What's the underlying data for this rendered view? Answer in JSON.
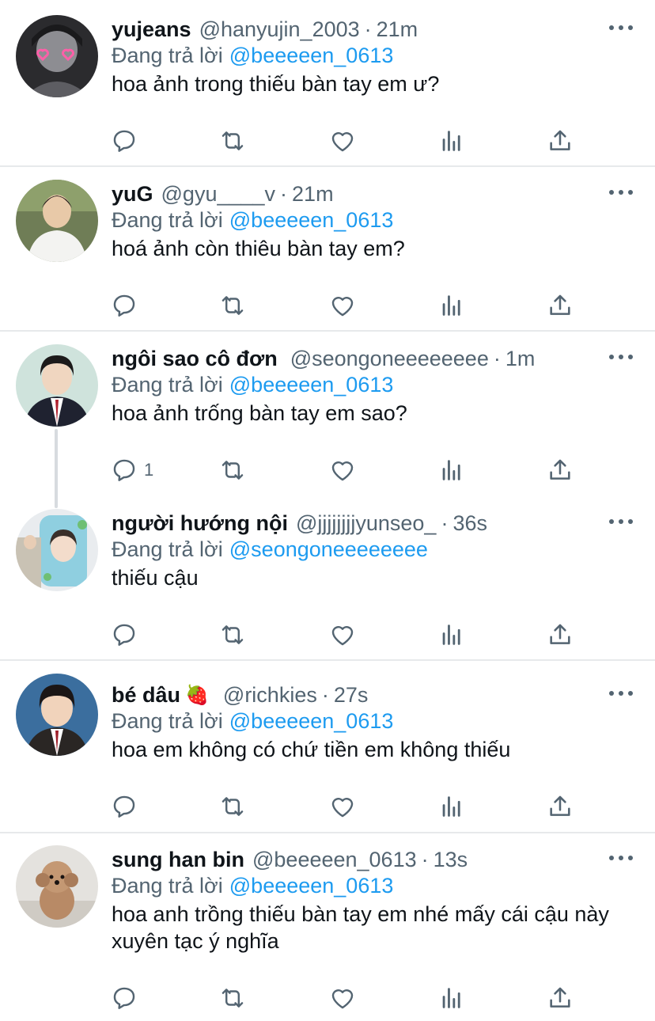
{
  "colors": {
    "accent": "#1d9bf0",
    "muted": "#536471",
    "text": "#0f1419",
    "divider": "#e7e9eb",
    "strawberry": "#e0245e"
  },
  "icons": {
    "reply": "speech-bubble",
    "retweet": "retweet-arrows",
    "like": "heart-outline",
    "analytics": "bar-chart",
    "share": "upload-arrow",
    "more": "three-dots"
  },
  "tweets": [
    {
      "name": "yujeans",
      "handle": "@hanyujin_2003",
      "time": "21m",
      "replying_label": "Đang trả lời",
      "reply_to": "@beeeeen_0613",
      "text": "hoa ảnh trong thiếu bàn tay em ư?",
      "reply_count": ""
    },
    {
      "name": "yuG",
      "handle": "@gyu____v",
      "time": "21m",
      "replying_label": "Đang trả lời",
      "reply_to": "@beeeeen_0613",
      "text": "hoá ảnh còn thiêu bàn tay em?",
      "reply_count": ""
    },
    {
      "name": "ngôi sao cô đơn",
      "handle": "@seongoneeeeeeee",
      "time": "1m",
      "replying_label": "Đang trả lời",
      "reply_to": "@beeeeen_0613",
      "text": "hoa ảnh trống bàn tay em sao?",
      "reply_count": "1"
    },
    {
      "name": "người hướng nội",
      "handle": "@jjjjjjjjyunseo_",
      "time": "36s",
      "replying_label": "Đang trả lời",
      "reply_to": "@seongoneeeeeeee",
      "text": "thiếu cậu",
      "reply_count": ""
    },
    {
      "name": "bé dâu",
      "name_emoji": "🍓",
      "handle": "@richkies",
      "time": "27s",
      "replying_label": "Đang trả lời",
      "reply_to": "@beeeeen_0613",
      "text": "hoa em không có chứ tiền em không thiếu",
      "reply_count": ""
    },
    {
      "name": "sung han bin",
      "handle": "@beeeeen_0613",
      "time": "13s",
      "replying_label": "Đang trả lời",
      "reply_to": "@beeeeen_0613",
      "text": "hoa anh trồng thiếu bàn tay em nhé mấy cái cậu này xuyên tạc ý nghĩa",
      "reply_count": ""
    }
  ]
}
